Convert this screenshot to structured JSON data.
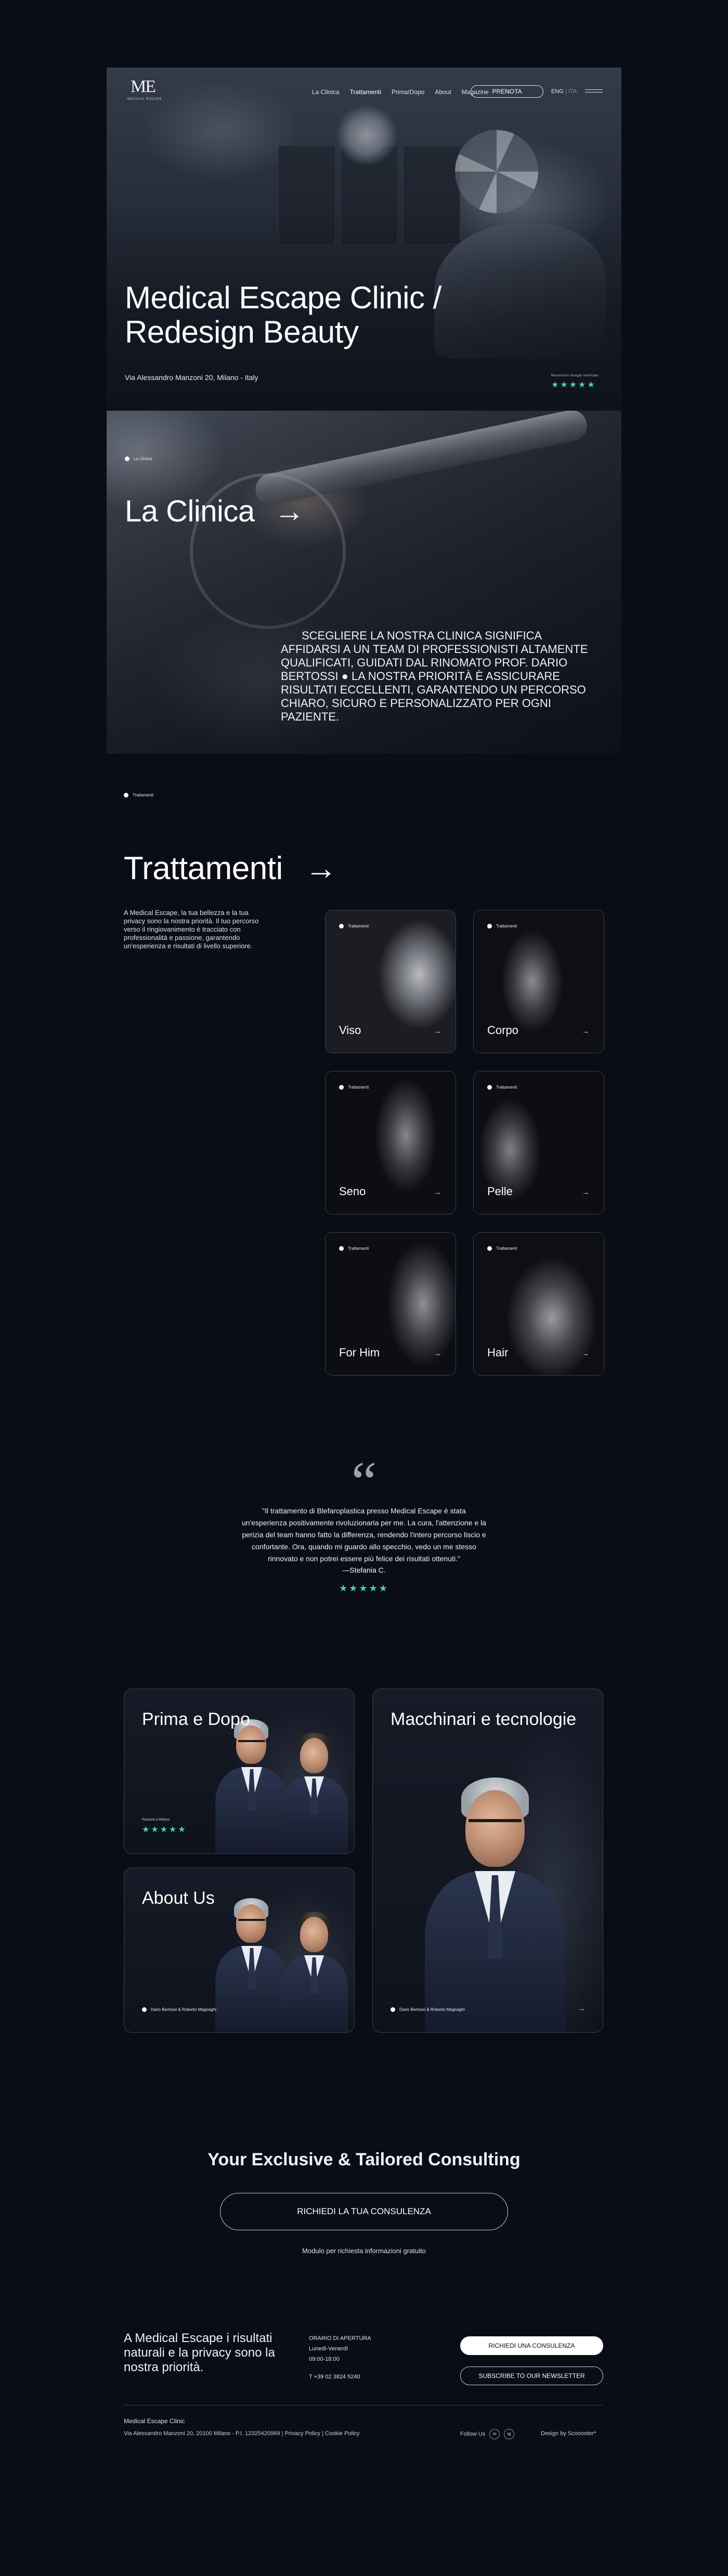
{
  "brand": {
    "logo_mark": "ME",
    "logo_sub": "MEDICAL ESCAPE"
  },
  "nav": {
    "items": [
      "La Clinica",
      "Trattamenti",
      "Prima/Dopo",
      "About",
      "Magazine"
    ],
    "active": "Trattamenti",
    "cta": "PRENOTA",
    "lang_active": "ENG",
    "lang_sep": "|",
    "lang_other": "ITA"
  },
  "hero": {
    "title": "Medical Escape Clinic / Redesign Beauty",
    "address": "Via Alessandro Manzoni 20, Milano - Italy",
    "rating_label": "Recensioni Google Verificate",
    "stars": "★★★★★"
  },
  "clinica": {
    "tag": "La Clinica",
    "title": "La Clinica",
    "arrow": "→",
    "text": "SCEGLIERE LA NOSTRA CLINICA SIGNIFICA AFFIDARSI A UN TEAM DI PROFESSIONISTI ALTAMENTE QUALIFICATI, GUIDATI DAL RINOMATO PROF. DARIO BERTOSSI ● LA NOSTRA PRIORITÀ È ASSICURARE RISULTATI ECCELLENTI, GARANTENDO UN PERCORSO CHIARO, SICURO E PERSONALIZZATO PER OGNI PAZIENTE."
  },
  "trattamenti": {
    "tag": "Trattamenti",
    "title": "Trattamenti",
    "arrow": "→",
    "description": "A Medical Escape, la tua bellezza e la tua privacy sono la nostra priorità. Il tuo percorso verso il ringiovanimento è tracciato con professionalità e passione, garantendo un'esperienza e risultati di livello superiore.",
    "card_tag": "Trattamenti",
    "card_arrow": "→",
    "cards": [
      {
        "name": "Viso"
      },
      {
        "name": "Corpo"
      },
      {
        "name": "Seno"
      },
      {
        "name": "Pelle"
      },
      {
        "name": "For Him"
      },
      {
        "name": "Hair"
      }
    ]
  },
  "testimonial": {
    "mark": "“",
    "text": "\"Il trattamento di Blefaroplastica presso Medical Escape è stata un'esperienza positivamente rivoluzionaria per me. La cura, l'attenzione e la perizia del team hanno fatto la differenza, rendendo l'intero percorso liscio e confortante. Ora, quando mi guardo allo specchio, vedo un me stesso rinnovato e non potrei essere più felice dei risultati ottenuti.\"",
    "author": "—Stefania C.",
    "stars": "★★★★★",
    "star_color": "#49d6a3"
  },
  "people": {
    "prima_dopo": {
      "title": "Prima e Dopo",
      "sub": "Pazienti a Milano",
      "stars": "★★★★★"
    },
    "about": {
      "title": "About Us",
      "tag": "Dario Bertossi & Roberto Magnaghi"
    },
    "macchinari": {
      "title": "Macchinari e tecnologie",
      "tag": "Dario Bertossi & Roberto Magnaghi",
      "arrow": "→"
    }
  },
  "cta": {
    "title": "Your Exclusive & Tailored Consulting",
    "button": "RICHIEDI LA TUA CONSULENZA",
    "note": "Modulo per richiesta informazioni gratuito"
  },
  "footer": {
    "claim": "A Medical Escape i risultati naturali e la privacy sono la nostra priorità.",
    "hours_title": "ORARIO DI APERTURA",
    "hours_days": "Lunedì-Venerdì",
    "hours_time": "09:00-18:00",
    "phone": "T +39 02 3824 5240",
    "btn_consult": "RICHIEDI UNA CONSULENZA",
    "btn_newsletter": "SUBSCRIBE TO OUR NEWSLETTER",
    "company": "Medical Escape Clinic",
    "address_line": "Via Alessandro Manzoni 20, 20100 Milano - P.I. 12325420969  |  Privacy Policy  |  Cookie Policy",
    "follow": "Follow Us",
    "social_1": "in",
    "social_2": "ig",
    "design": "Design by Scooooter*"
  }
}
